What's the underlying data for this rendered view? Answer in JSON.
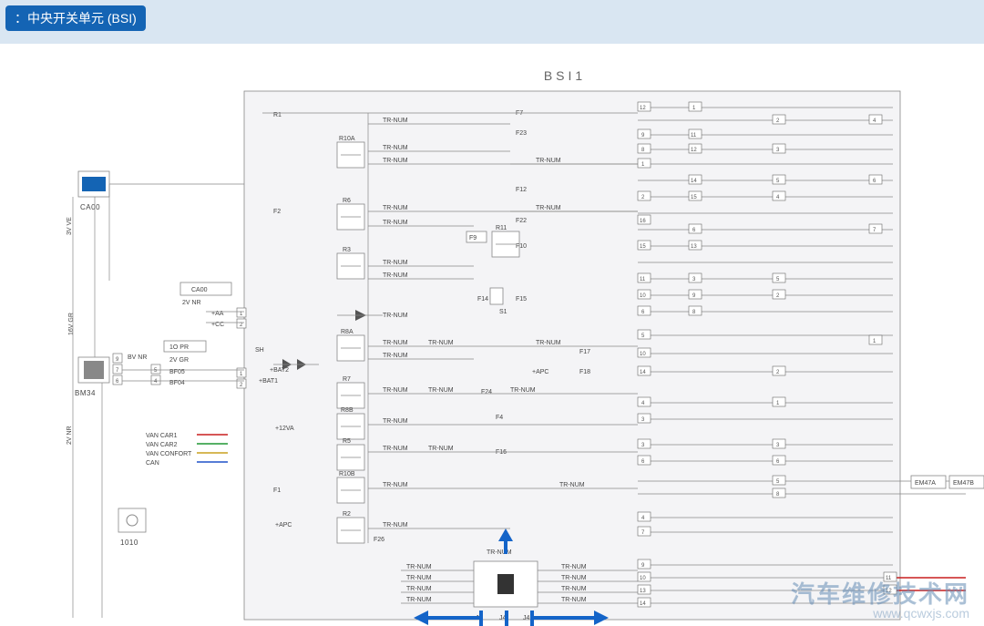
{
  "header": {
    "title": "：中央开关单元 (BSI)"
  },
  "block_title": "BSI1",
  "modules": {
    "ca00": {
      "name": "CA00"
    },
    "bm34": {
      "name": "BM34"
    },
    "io10": {
      "name": "1010"
    },
    "title_box": {
      "name": "CA00",
      "sub": "2V NR",
      "plus_aa": "+AA",
      "plus_cc": "+CC"
    }
  },
  "wire_labels": {
    "left_vert_1": "3V VE",
    "left_vert_2": "16V GR",
    "left_vert_3": "2V NR",
    "bv_nr": "BV NR",
    "pr10": "1O PR",
    "gr2v": "2V GR",
    "bf05": "BF05",
    "bf04": "BF04"
  },
  "internal": {
    "sh": "SH",
    "bat1": "+BAT1",
    "bat2": "+BAT2",
    "apc": "+APC",
    "va12": "+12VA"
  },
  "relays": [
    "R1",
    "R2",
    "R3",
    "R5",
    "R6",
    "R7",
    "R8A",
    "R8B",
    "R10A",
    "R10B",
    "R11"
  ],
  "fuses_top": [
    "F1",
    "F2",
    "F7",
    "F23"
  ],
  "fuses_mid": [
    "F9",
    "F12",
    "F22",
    "F10",
    "F14",
    "F15"
  ],
  "fuses_low": [
    "F17",
    "F18",
    "F24",
    "F4",
    "F16",
    "F26"
  ],
  "ext_conn": [
    "EM47A",
    "EM47B"
  ],
  "signal_generic": "TR-NUM",
  "bus_conn": "J4",
  "legend": [
    {
      "label": "VAN CAR1",
      "class": "legend-r"
    },
    {
      "label": "VAN CAR2",
      "class": "legend-g"
    },
    {
      "label": "VAN CONFORT",
      "class": "legend-y"
    },
    {
      "label": "CAN",
      "class": "legend-b"
    }
  ],
  "pins_right_visible": [
    "1",
    "2",
    "3",
    "4",
    "5",
    "6",
    "7",
    "8",
    "9",
    "10",
    "11",
    "12",
    "13",
    "14",
    "15",
    "16"
  ],
  "watermark": {
    "cn": "汽车维修技术网",
    "url": "www.qcwxjs.com"
  }
}
